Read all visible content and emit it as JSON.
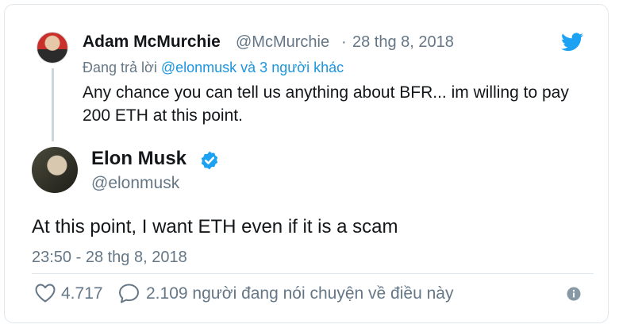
{
  "reply_tweet": {
    "author_name": "Adam McMurchie",
    "handle": "@McMurchie",
    "separator": "·",
    "date": "28 thg 8, 2018",
    "replying_prefix": "Đang trả lời",
    "replying_users": "@elonmusk và 3 người khác",
    "text": "Any chance you can tell us anything about BFR... im willing to pay 200 ETH at this point."
  },
  "main_tweet": {
    "author_name": "Elon Musk",
    "handle": "@elonmusk",
    "text": "At this point, I want ETH even if it is a scam",
    "timestamp": "23:50 - 28 thg 8, 2018"
  },
  "actions": {
    "like_count": "4.717",
    "talk_text": "2.109 người đang nói chuyện về điều này"
  },
  "icons": {
    "brand": "twitter-bird-icon",
    "verified": "verified-badge-icon",
    "like": "heart-icon",
    "reply": "speech-bubble-icon",
    "info": "info-icon"
  },
  "colors": {
    "brand_blue": "#1da1f2",
    "link_blue": "#1b95e0",
    "secondary_text": "#657786",
    "primary_text": "#14171a",
    "border": "#e1e8ed"
  }
}
